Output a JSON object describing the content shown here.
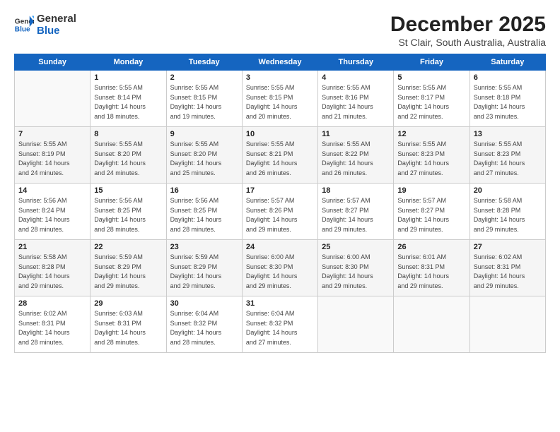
{
  "brand": {
    "name_general": "General",
    "name_blue": "Blue"
  },
  "title": "December 2025",
  "subtitle": "St Clair, South Australia, Australia",
  "header": {
    "days": [
      "Sunday",
      "Monday",
      "Tuesday",
      "Wednesday",
      "Thursday",
      "Friday",
      "Saturday"
    ]
  },
  "weeks": [
    [
      {
        "num": "",
        "info": ""
      },
      {
        "num": "1",
        "info": "Sunrise: 5:55 AM\nSunset: 8:14 PM\nDaylight: 14 hours\nand 18 minutes."
      },
      {
        "num": "2",
        "info": "Sunrise: 5:55 AM\nSunset: 8:15 PM\nDaylight: 14 hours\nand 19 minutes."
      },
      {
        "num": "3",
        "info": "Sunrise: 5:55 AM\nSunset: 8:15 PM\nDaylight: 14 hours\nand 20 minutes."
      },
      {
        "num": "4",
        "info": "Sunrise: 5:55 AM\nSunset: 8:16 PM\nDaylight: 14 hours\nand 21 minutes."
      },
      {
        "num": "5",
        "info": "Sunrise: 5:55 AM\nSunset: 8:17 PM\nDaylight: 14 hours\nand 22 minutes."
      },
      {
        "num": "6",
        "info": "Sunrise: 5:55 AM\nSunset: 8:18 PM\nDaylight: 14 hours\nand 23 minutes."
      }
    ],
    [
      {
        "num": "7",
        "info": "Sunrise: 5:55 AM\nSunset: 8:19 PM\nDaylight: 14 hours\nand 24 minutes."
      },
      {
        "num": "8",
        "info": "Sunrise: 5:55 AM\nSunset: 8:20 PM\nDaylight: 14 hours\nand 24 minutes."
      },
      {
        "num": "9",
        "info": "Sunrise: 5:55 AM\nSunset: 8:20 PM\nDaylight: 14 hours\nand 25 minutes."
      },
      {
        "num": "10",
        "info": "Sunrise: 5:55 AM\nSunset: 8:21 PM\nDaylight: 14 hours\nand 26 minutes."
      },
      {
        "num": "11",
        "info": "Sunrise: 5:55 AM\nSunset: 8:22 PM\nDaylight: 14 hours\nand 26 minutes."
      },
      {
        "num": "12",
        "info": "Sunrise: 5:55 AM\nSunset: 8:23 PM\nDaylight: 14 hours\nand 27 minutes."
      },
      {
        "num": "13",
        "info": "Sunrise: 5:55 AM\nSunset: 8:23 PM\nDaylight: 14 hours\nand 27 minutes."
      }
    ],
    [
      {
        "num": "14",
        "info": "Sunrise: 5:56 AM\nSunset: 8:24 PM\nDaylight: 14 hours\nand 28 minutes."
      },
      {
        "num": "15",
        "info": "Sunrise: 5:56 AM\nSunset: 8:25 PM\nDaylight: 14 hours\nand 28 minutes."
      },
      {
        "num": "16",
        "info": "Sunrise: 5:56 AM\nSunset: 8:25 PM\nDaylight: 14 hours\nand 28 minutes."
      },
      {
        "num": "17",
        "info": "Sunrise: 5:57 AM\nSunset: 8:26 PM\nDaylight: 14 hours\nand 29 minutes."
      },
      {
        "num": "18",
        "info": "Sunrise: 5:57 AM\nSunset: 8:27 PM\nDaylight: 14 hours\nand 29 minutes."
      },
      {
        "num": "19",
        "info": "Sunrise: 5:57 AM\nSunset: 8:27 PM\nDaylight: 14 hours\nand 29 minutes."
      },
      {
        "num": "20",
        "info": "Sunrise: 5:58 AM\nSunset: 8:28 PM\nDaylight: 14 hours\nand 29 minutes."
      }
    ],
    [
      {
        "num": "21",
        "info": "Sunrise: 5:58 AM\nSunset: 8:28 PM\nDaylight: 14 hours\nand 29 minutes."
      },
      {
        "num": "22",
        "info": "Sunrise: 5:59 AM\nSunset: 8:29 PM\nDaylight: 14 hours\nand 29 minutes."
      },
      {
        "num": "23",
        "info": "Sunrise: 5:59 AM\nSunset: 8:29 PM\nDaylight: 14 hours\nand 29 minutes."
      },
      {
        "num": "24",
        "info": "Sunrise: 6:00 AM\nSunset: 8:30 PM\nDaylight: 14 hours\nand 29 minutes."
      },
      {
        "num": "25",
        "info": "Sunrise: 6:00 AM\nSunset: 8:30 PM\nDaylight: 14 hours\nand 29 minutes."
      },
      {
        "num": "26",
        "info": "Sunrise: 6:01 AM\nSunset: 8:31 PM\nDaylight: 14 hours\nand 29 minutes."
      },
      {
        "num": "27",
        "info": "Sunrise: 6:02 AM\nSunset: 8:31 PM\nDaylight: 14 hours\nand 29 minutes."
      }
    ],
    [
      {
        "num": "28",
        "info": "Sunrise: 6:02 AM\nSunset: 8:31 PM\nDaylight: 14 hours\nand 28 minutes."
      },
      {
        "num": "29",
        "info": "Sunrise: 6:03 AM\nSunset: 8:31 PM\nDaylight: 14 hours\nand 28 minutes."
      },
      {
        "num": "30",
        "info": "Sunrise: 6:04 AM\nSunset: 8:32 PM\nDaylight: 14 hours\nand 28 minutes."
      },
      {
        "num": "31",
        "info": "Sunrise: 6:04 AM\nSunset: 8:32 PM\nDaylight: 14 hours\nand 27 minutes."
      },
      {
        "num": "",
        "info": ""
      },
      {
        "num": "",
        "info": ""
      },
      {
        "num": "",
        "info": ""
      }
    ]
  ]
}
